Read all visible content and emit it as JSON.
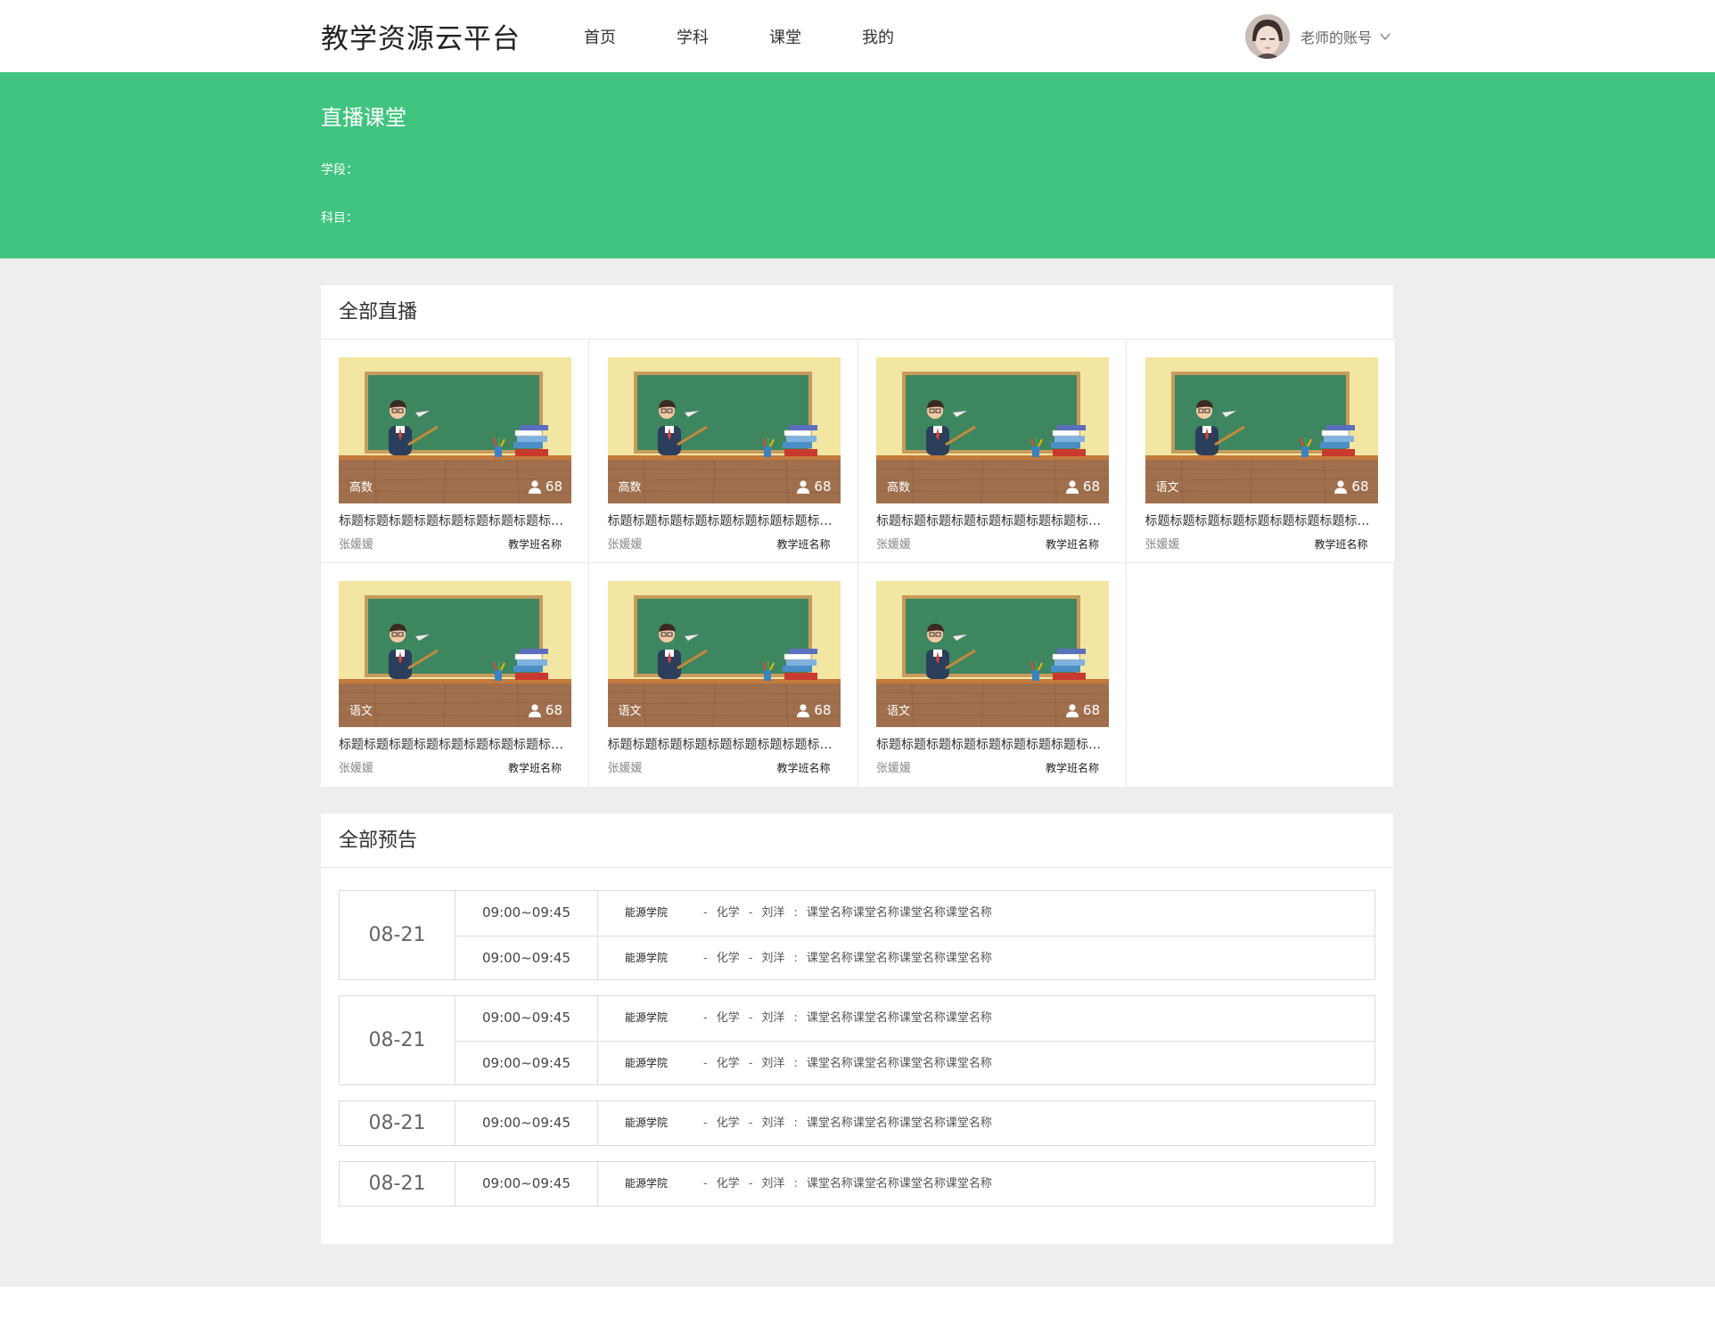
{
  "header": {
    "logo": "教学资源云平台",
    "nav": [
      "首页",
      "学科",
      "课堂",
      "我的"
    ],
    "account_name": "老师的账号"
  },
  "banner": {
    "title": "直播课堂",
    "filter_stage": "学段：",
    "filter_subject": "科目："
  },
  "live": {
    "title": "全部直播",
    "cards": [
      {
        "tag": "高数",
        "viewers": "68",
        "title": "标题标题标题标题标题标题标题标题标题标题标题",
        "teacher": "张媛媛",
        "class_name": "教学班名称"
      },
      {
        "tag": "高数",
        "viewers": "68",
        "title": "标题标题标题标题标题标题标题标题标题标题标题",
        "teacher": "张媛媛",
        "class_name": "教学班名称"
      },
      {
        "tag": "高数",
        "viewers": "68",
        "title": "标题标题标题标题标题标题标题标题标题标题标题",
        "teacher": "张媛媛",
        "class_name": "教学班名称"
      },
      {
        "tag": "语文",
        "viewers": "68",
        "title": "标题标题标题标题标题标题标题标题标题标题标题",
        "teacher": "张媛媛",
        "class_name": "教学班名称"
      },
      {
        "tag": "语文",
        "viewers": "68",
        "title": "标题标题标题标题标题标题标题标题标题标题标题",
        "teacher": "张媛媛",
        "class_name": "教学班名称"
      },
      {
        "tag": "语文",
        "viewers": "68",
        "title": "标题标题标题标题标题标题标题标题标题标题标题",
        "teacher": "张媛媛",
        "class_name": "教学班名称"
      },
      {
        "tag": "语文",
        "viewers": "68",
        "title": "标题标题标题标题标题标题标题标题标题标题标题",
        "teacher": "张媛媛",
        "class_name": "教学班名称"
      }
    ]
  },
  "preview": {
    "title": "全部预告",
    "groups": [
      {
        "date": "08-21",
        "rows": [
          {
            "time": "09:00~09:45",
            "school": "能源学院",
            "subject": "化学",
            "teacher": "刘洋",
            "course": "课堂名称课堂名称课堂名称课堂名称"
          },
          {
            "time": "09:00~09:45",
            "school": "能源学院",
            "subject": "化学",
            "teacher": "刘洋",
            "course": "课堂名称课堂名称课堂名称课堂名称"
          }
        ]
      },
      {
        "date": "08-21",
        "rows": [
          {
            "time": "09:00~09:45",
            "school": "能源学院",
            "subject": "化学",
            "teacher": "刘洋",
            "course": "课堂名称课堂名称课堂名称课堂名称"
          },
          {
            "time": "09:00~09:45",
            "school": "能源学院",
            "subject": "化学",
            "teacher": "刘洋",
            "course": "课堂名称课堂名称课堂名称课堂名称"
          }
        ]
      },
      {
        "date": "08-21",
        "rows": [
          {
            "time": "09:00~09:45",
            "school": "能源学院",
            "subject": "化学",
            "teacher": "刘洋",
            "course": "课堂名称课堂名称课堂名称课堂名称"
          }
        ]
      },
      {
        "date": "08-21",
        "rows": [
          {
            "time": "09:00~09:45",
            "school": "能源学院",
            "subject": "化学",
            "teacher": "刘洋",
            "course": "课堂名称课堂名称课堂名称课堂名称"
          }
        ]
      }
    ]
  },
  "colors": {
    "brand_green": "#40c47f",
    "page_grey": "#eeeeee"
  }
}
